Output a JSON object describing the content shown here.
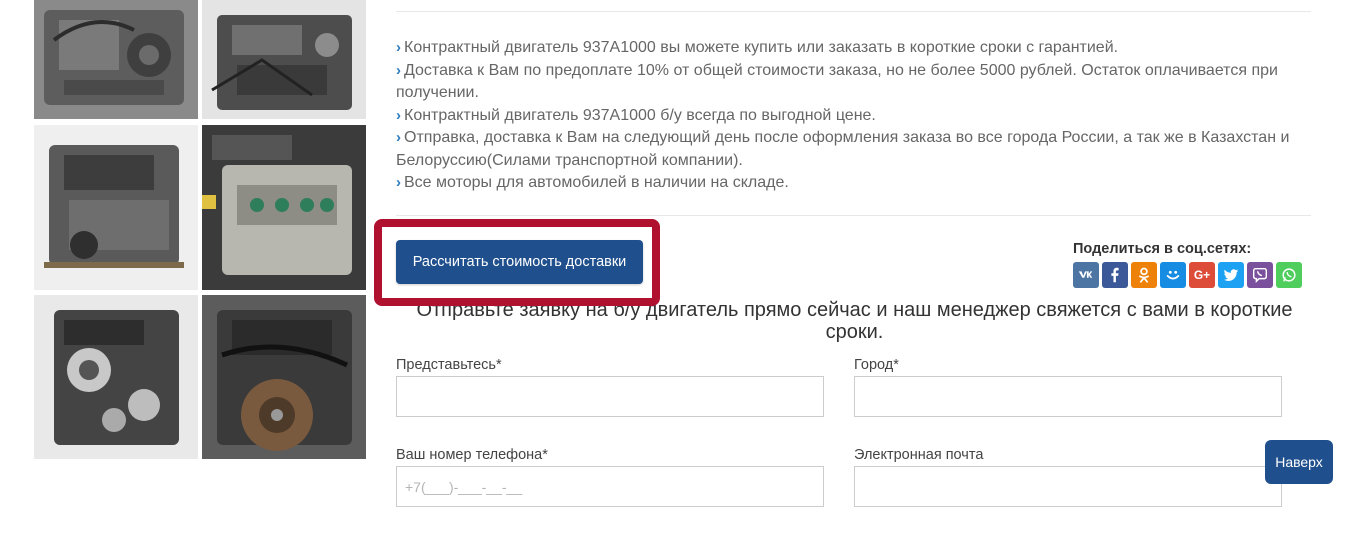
{
  "gallery": {
    "images": [
      {
        "alt": "engine-photo-1"
      },
      {
        "alt": "engine-photo-2"
      },
      {
        "alt": "engine-photo-3"
      },
      {
        "alt": "engine-photo-4"
      },
      {
        "alt": "engine-photo-5"
      },
      {
        "alt": "engine-photo-6"
      }
    ]
  },
  "info": {
    "items": [
      "Контрактный двигатель 937A1000 вы можете купить или заказать в короткие сроки с гарантией.",
      "Доставка к Вам по предоплате 10% от общей стоимости заказа, но не более 5000 рублей. Остаток оплачивается при получении.",
      "Контрактный двигатель 937A1000 б/у всегда по выгодной цене.",
      "Отправка, доставка к Вам на следующий день после оформления заказа во все города России, а так же в Казахстан и Белоруссию(Силами транспортной компании).",
      "Все моторы для автомобилей в наличии на складе."
    ]
  },
  "delivery": {
    "button_label": "Рассчитать стоимость доставки",
    "highlight_color": "#b0112f"
  },
  "share": {
    "title": "Поделиться в соц.сетях:",
    "icons": [
      {
        "name": "vk-icon",
        "color": "#4c75a3"
      },
      {
        "name": "facebook-icon",
        "color": "#3b5998"
      },
      {
        "name": "odnoklassniki-icon",
        "color": "#ee8208"
      },
      {
        "name": "moimir-icon",
        "color": "#168de2"
      },
      {
        "name": "googleplus-icon",
        "color": "#dd4b39"
      },
      {
        "name": "twitter-icon",
        "color": "#1da1f2"
      },
      {
        "name": "viber-icon",
        "color": "#7b519d"
      },
      {
        "name": "whatsapp-icon",
        "color": "#4fce5d"
      }
    ]
  },
  "form": {
    "title": "Отправьте заявку на б/у двигатель прямо сейчас и наш менеджер свяжется с вами в короткие сроки.",
    "name_label": "Представьтесь*",
    "city_label": "Город*",
    "phone_label": "Ваш номер телефона*",
    "phone_placeholder": "+7(___)-___-__-__",
    "email_label": "Электронная почта"
  },
  "back_to_top": {
    "label": "Наверх"
  },
  "colors": {
    "primary_button": "#1f4f8c",
    "bullet": "#2a7bbf"
  }
}
